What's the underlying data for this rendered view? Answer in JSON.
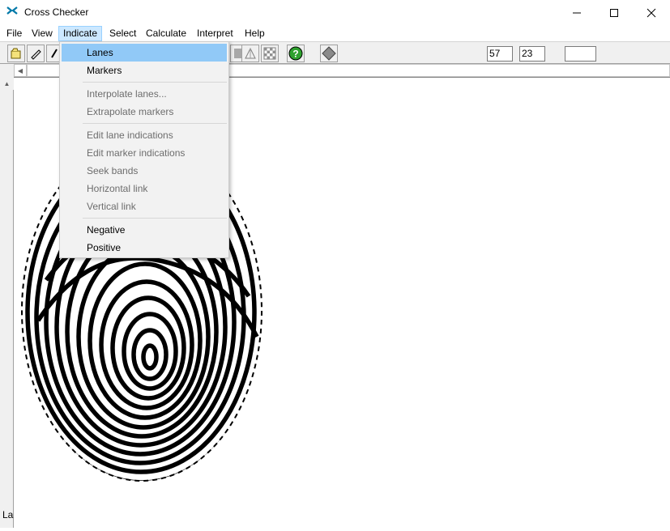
{
  "window": {
    "title": "Cross Checker",
    "controls": [
      "minimize",
      "maximize",
      "close"
    ]
  },
  "menubar": {
    "items": [
      "File",
      "View",
      "Indicate",
      "Select",
      "Calculate",
      "Interpret",
      "Help"
    ],
    "active": "Indicate"
  },
  "indicate_menu": {
    "items": [
      {
        "label": "Lanes",
        "enabled": true,
        "highlighted": true
      },
      {
        "label": "Markers",
        "enabled": true
      },
      {
        "label": "Interpolate lanes...",
        "enabled": false
      },
      {
        "label": "Extrapolate markers",
        "enabled": false
      },
      {
        "label": "Edit lane indications",
        "enabled": false
      },
      {
        "label": "Edit marker indications",
        "enabled": false
      },
      {
        "label": "Seek bands",
        "enabled": false
      },
      {
        "label": "Horizontal link",
        "enabled": false
      },
      {
        "label": "Vertical link",
        "enabled": false
      },
      {
        "label": "Negative",
        "enabled": true
      },
      {
        "label": "Positive",
        "enabled": true
      }
    ]
  },
  "toolbar": {
    "field_1": "57",
    "field_2": "23",
    "field_3": ""
  },
  "status": {
    "left_label": "La"
  },
  "colors": {
    "menu_highlight": "#91c9f7",
    "help_button": "#2ea12e"
  }
}
